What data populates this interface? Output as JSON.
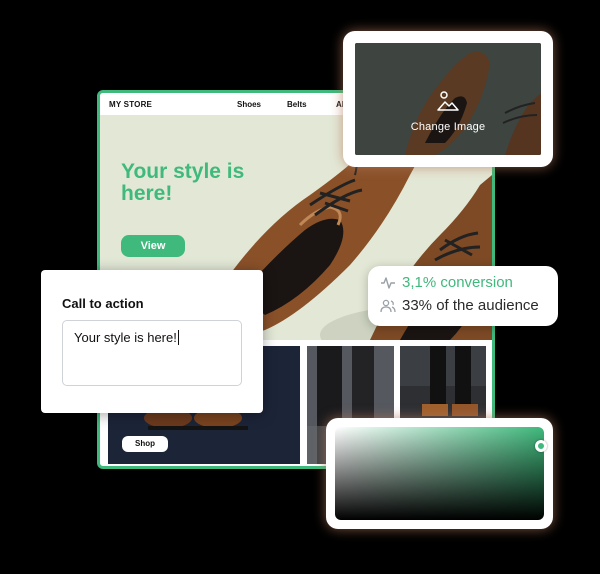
{
  "store": {
    "brand": "MY STORE",
    "nav": [
      "Shoes",
      "Belts",
      "Ab"
    ],
    "hero_title": "Your style is here!",
    "view_button": "View",
    "shop_button": "Shop"
  },
  "image_card": {
    "label": "Change Image",
    "icon": "image-icon"
  },
  "stats": {
    "conversion": "3,1% conversion",
    "audience": "33% of the audience",
    "conversion_icon": "activity-icon",
    "audience_icon": "users-icon"
  },
  "cta_card": {
    "title": "Call to action",
    "value": "Your style is here!"
  },
  "colors": {
    "accent": "#3fb97c",
    "hero_bg": "#e3e8d6",
    "shoe_brown": "#8a5129"
  }
}
